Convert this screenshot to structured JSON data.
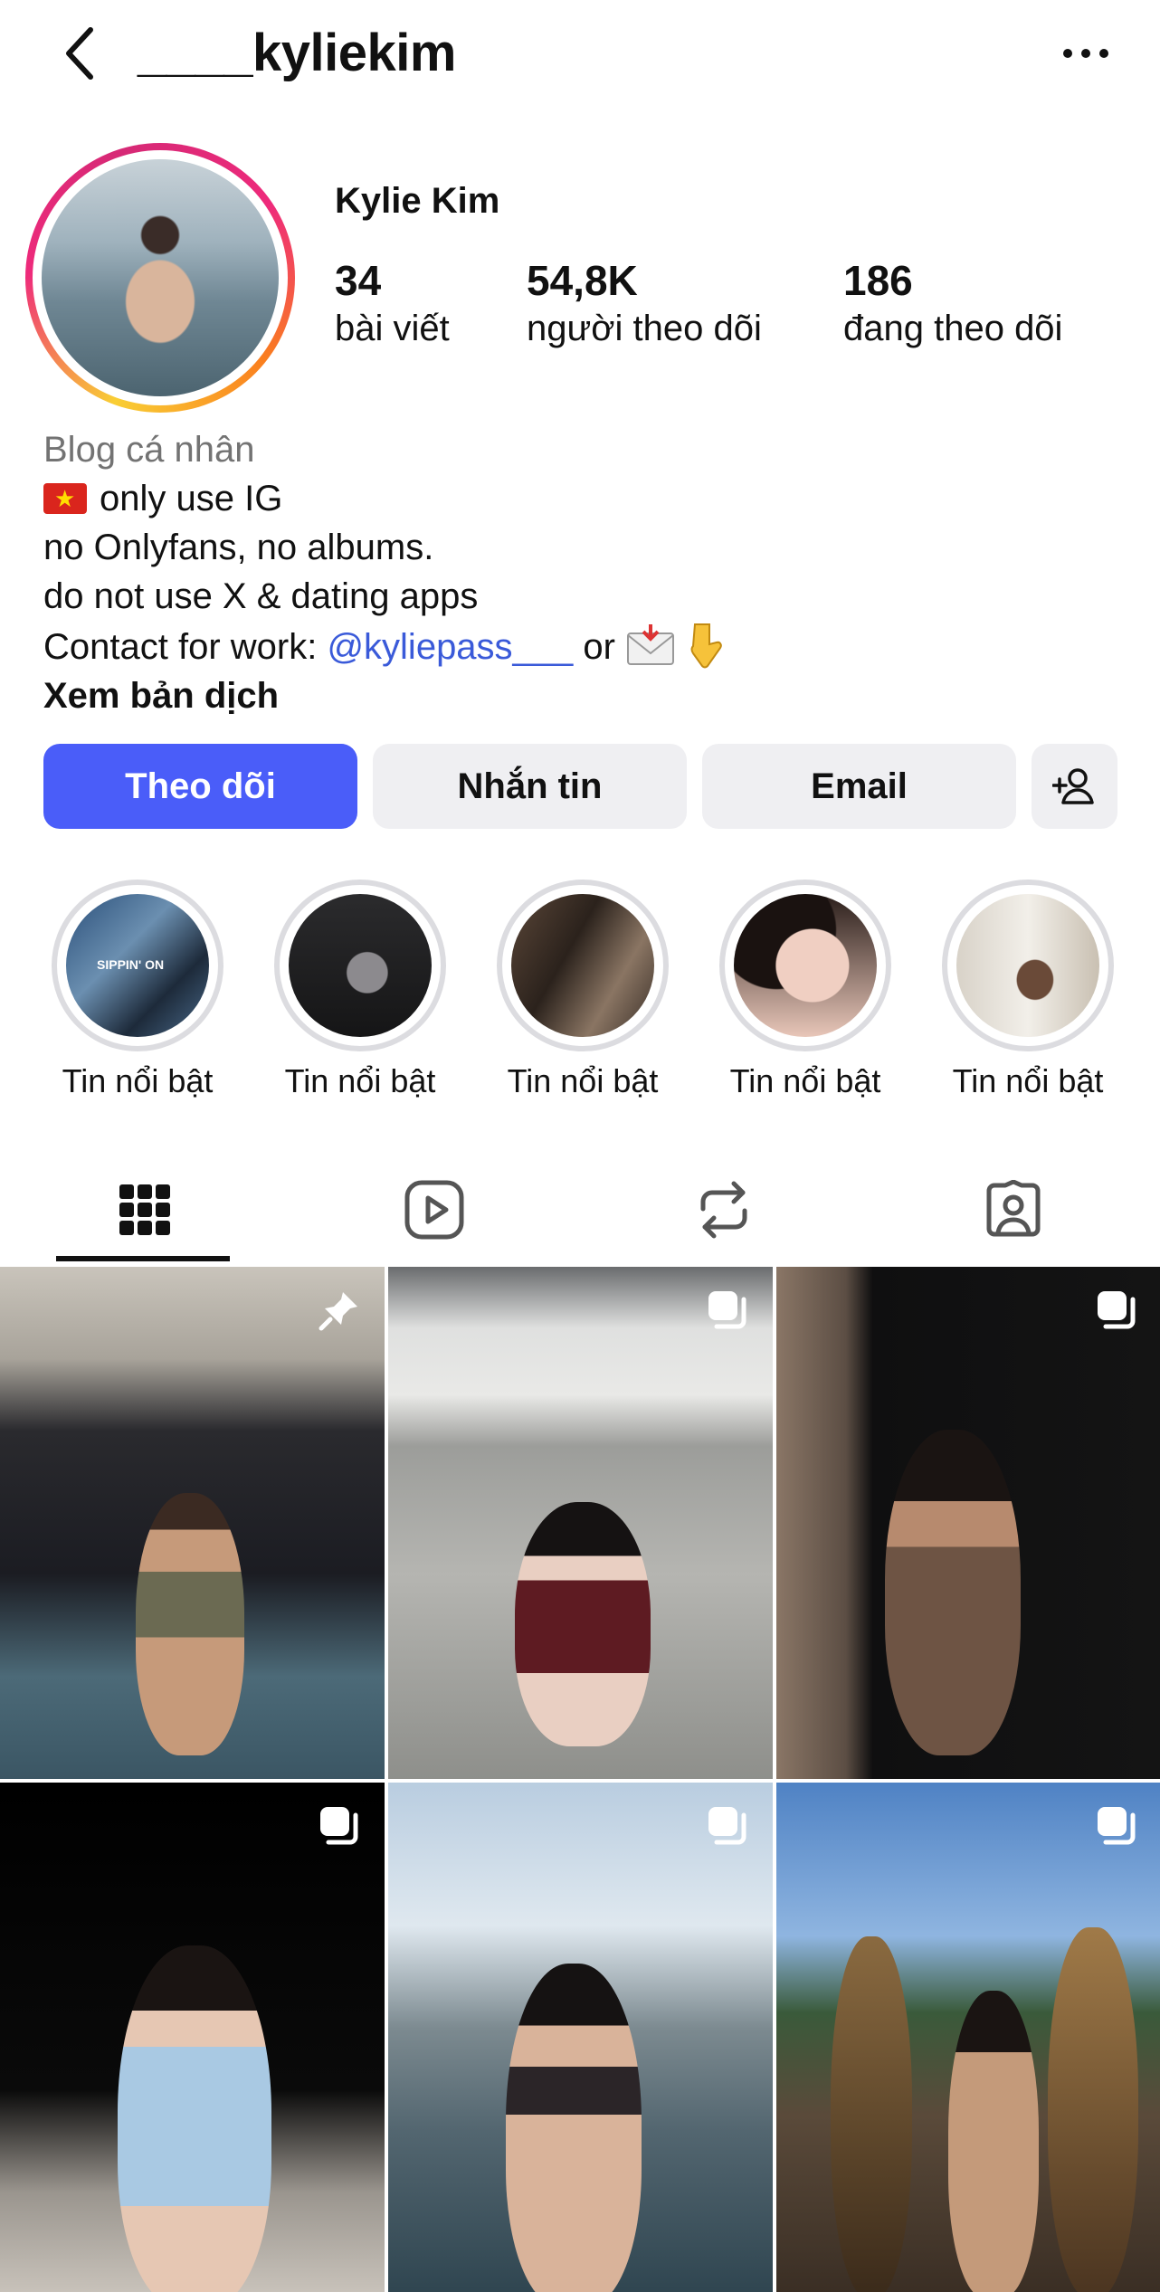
{
  "header": {
    "username": "____kyliekim"
  },
  "profile": {
    "display_name": "Kylie Kim",
    "stats": [
      {
        "value": "34",
        "label": "bài viết"
      },
      {
        "value": "54,8K",
        "label": "người theo dõi"
      },
      {
        "value": "186",
        "label": "đang theo dõi"
      }
    ]
  },
  "bio": {
    "category": "Blog cá nhân",
    "line1": "only use IG",
    "line2": "no Onlyfans, no albums.",
    "line3": "do not use X & dating apps",
    "line4_prefix": "Contact for work: ",
    "mention": "@kyliepass___",
    "line4_suffix": " or",
    "see_translation": "Xem bản dịch"
  },
  "actions": {
    "follow": "Theo dõi",
    "message": "Nhắn tin",
    "email": "Email"
  },
  "highlights": [
    {
      "label": "Tin nổi bật"
    },
    {
      "label": "Tin nổi bật"
    },
    {
      "label": "Tin nổi bật"
    },
    {
      "label": "Tin nổi bật"
    },
    {
      "label": "Tin nổi bật"
    }
  ],
  "highlight_first_text": "SIPPIN' ON",
  "tabs": [
    {
      "icon": "grid-icon",
      "active": true
    },
    {
      "icon": "reels-icon",
      "active": false
    },
    {
      "icon": "reposts-icon",
      "active": false
    },
    {
      "icon": "tagged-icon",
      "active": false
    }
  ],
  "posts": [
    {
      "badge": "pin-icon"
    },
    {
      "badge": "carousel-icon"
    },
    {
      "badge": "carousel-icon"
    },
    {
      "badge": "carousel-icon"
    },
    {
      "badge": "carousel-icon"
    },
    {
      "badge": "carousel-icon"
    }
  ],
  "colors": {
    "follow_button": "#4a5df9",
    "secondary_button": "#efeff2",
    "mention": "#3a5ad9",
    "category": "#737373"
  }
}
